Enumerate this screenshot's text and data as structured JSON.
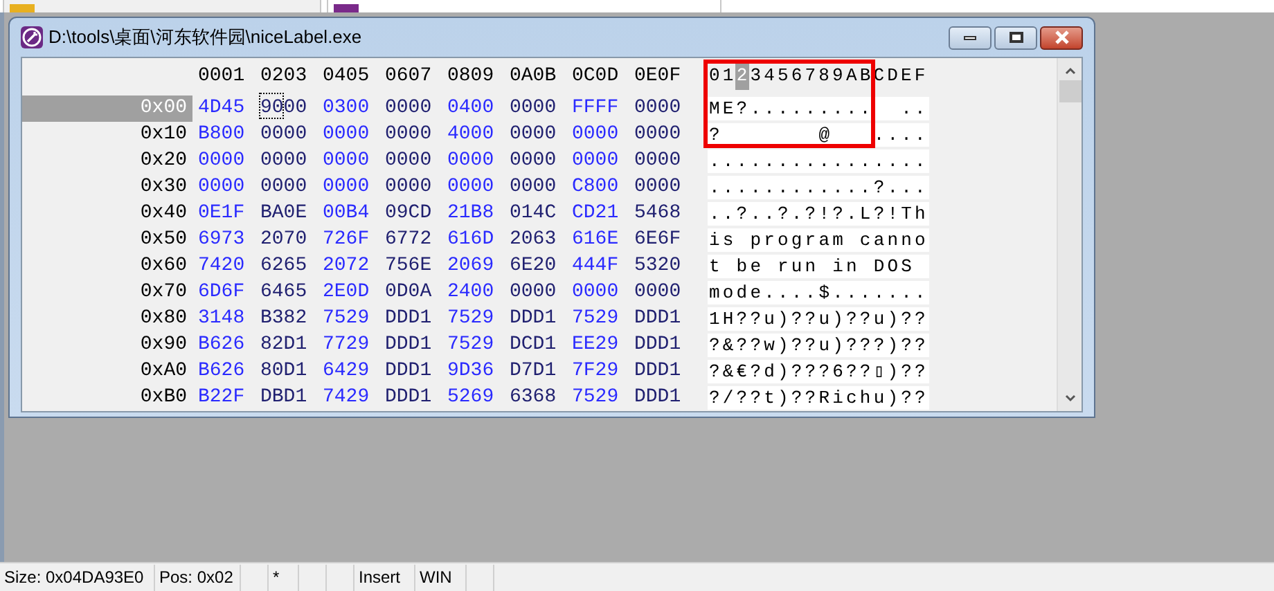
{
  "tabs": [
    {
      "selected": false
    },
    {
      "selected": true
    }
  ],
  "window": {
    "title": "D:\\tools\\桌面\\河东软件园\\niceLabel.exe"
  },
  "hex_columns": [
    "0001",
    "0203",
    "0405",
    "0607",
    "0809",
    "0A0B",
    "0C0D",
    "0E0F"
  ],
  "ascii_header": [
    {
      "char": "0",
      "selected": false
    },
    {
      "char": "1",
      "selected": false
    },
    {
      "char": "2",
      "selected": true
    },
    {
      "char": "3",
      "selected": false
    },
    {
      "char": "4",
      "selected": false
    },
    {
      "char": "5",
      "selected": false
    },
    {
      "char": "6",
      "selected": false
    },
    {
      "char": "7",
      "selected": false
    },
    {
      "char": "8",
      "selected": false
    },
    {
      "char": "9",
      "selected": false
    },
    {
      "char": "A",
      "selected": false
    },
    {
      "char": "B",
      "selected": false
    },
    {
      "char": "C",
      "selected": false
    },
    {
      "char": "D",
      "selected": false
    },
    {
      "char": "E",
      "selected": false
    },
    {
      "char": "F",
      "selected": false
    }
  ],
  "rows": [
    {
      "address": "0x00",
      "selected": true,
      "cells": [
        {
          "text": "4D45",
          "cursor": false
        },
        {
          "text": "9000",
          "cursor": true
        },
        {
          "text": "0300",
          "cursor": false
        },
        {
          "text": "0000",
          "cursor": false
        },
        {
          "text": "0400",
          "cursor": false
        },
        {
          "text": "0000",
          "cursor": false
        },
        {
          "text": "FFFF",
          "cursor": false
        },
        {
          "text": "0000",
          "cursor": false
        }
      ],
      "ascii": "ME?.........  .."
    },
    {
      "address": "0x10",
      "selected": false,
      "cells": [
        {
          "text": "B800",
          "cursor": false
        },
        {
          "text": "0000",
          "cursor": false
        },
        {
          "text": "0000",
          "cursor": false
        },
        {
          "text": "0000",
          "cursor": false
        },
        {
          "text": "4000",
          "cursor": false
        },
        {
          "text": "0000",
          "cursor": false
        },
        {
          "text": "0000",
          "cursor": false
        },
        {
          "text": "0000",
          "cursor": false
        }
      ],
      "ascii": "?       @   ...."
    },
    {
      "address": "0x20",
      "selected": false,
      "cells": [
        {
          "text": "0000",
          "cursor": false
        },
        {
          "text": "0000",
          "cursor": false
        },
        {
          "text": "0000",
          "cursor": false
        },
        {
          "text": "0000",
          "cursor": false
        },
        {
          "text": "0000",
          "cursor": false
        },
        {
          "text": "0000",
          "cursor": false
        },
        {
          "text": "0000",
          "cursor": false
        },
        {
          "text": "0000",
          "cursor": false
        }
      ],
      "ascii": "................"
    },
    {
      "address": "0x30",
      "selected": false,
      "cells": [
        {
          "text": "0000",
          "cursor": false
        },
        {
          "text": "0000",
          "cursor": false
        },
        {
          "text": "0000",
          "cursor": false
        },
        {
          "text": "0000",
          "cursor": false
        },
        {
          "text": "0000",
          "cursor": false
        },
        {
          "text": "0000",
          "cursor": false
        },
        {
          "text": "C800",
          "cursor": false
        },
        {
          "text": "0000",
          "cursor": false
        }
      ],
      "ascii": "............?..."
    },
    {
      "address": "0x40",
      "selected": false,
      "cells": [
        {
          "text": "0E1F",
          "cursor": false
        },
        {
          "text": "BA0E",
          "cursor": false
        },
        {
          "text": "00B4",
          "cursor": false
        },
        {
          "text": "09CD",
          "cursor": false
        },
        {
          "text": "21B8",
          "cursor": false
        },
        {
          "text": "014C",
          "cursor": false
        },
        {
          "text": "CD21",
          "cursor": false
        },
        {
          "text": "5468",
          "cursor": false
        }
      ],
      "ascii": "..?..?.?!?.L?!Th"
    },
    {
      "address": "0x50",
      "selected": false,
      "cells": [
        {
          "text": "6973",
          "cursor": false
        },
        {
          "text": "2070",
          "cursor": false
        },
        {
          "text": "726F",
          "cursor": false
        },
        {
          "text": "6772",
          "cursor": false
        },
        {
          "text": "616D",
          "cursor": false
        },
        {
          "text": "2063",
          "cursor": false
        },
        {
          "text": "616E",
          "cursor": false
        },
        {
          "text": "6E6F",
          "cursor": false
        }
      ],
      "ascii": "is program canno"
    },
    {
      "address": "0x60",
      "selected": false,
      "cells": [
        {
          "text": "7420",
          "cursor": false
        },
        {
          "text": "6265",
          "cursor": false
        },
        {
          "text": "2072",
          "cursor": false
        },
        {
          "text": "756E",
          "cursor": false
        },
        {
          "text": "2069",
          "cursor": false
        },
        {
          "text": "6E20",
          "cursor": false
        },
        {
          "text": "444F",
          "cursor": false
        },
        {
          "text": "5320",
          "cursor": false
        }
      ],
      "ascii": "t be run in DOS"
    },
    {
      "address": "0x70",
      "selected": false,
      "cells": [
        {
          "text": "6D6F",
          "cursor": false
        },
        {
          "text": "6465",
          "cursor": false
        },
        {
          "text": "2E0D",
          "cursor": false
        },
        {
          "text": "0D0A",
          "cursor": false
        },
        {
          "text": "2400",
          "cursor": false
        },
        {
          "text": "0000",
          "cursor": false
        },
        {
          "text": "0000",
          "cursor": false
        },
        {
          "text": "0000",
          "cursor": false
        }
      ],
      "ascii": "mode....$......."
    },
    {
      "address": "0x80",
      "selected": false,
      "cells": [
        {
          "text": "3148",
          "cursor": false
        },
        {
          "text": "B382",
          "cursor": false
        },
        {
          "text": "7529",
          "cursor": false
        },
        {
          "text": "DDD1",
          "cursor": false
        },
        {
          "text": "7529",
          "cursor": false
        },
        {
          "text": "DDD1",
          "cursor": false
        },
        {
          "text": "7529",
          "cursor": false
        },
        {
          "text": "DDD1",
          "cursor": false
        }
      ],
      "ascii": "1H??u)??u)??u)??"
    },
    {
      "address": "0x90",
      "selected": false,
      "cells": [
        {
          "text": "B626",
          "cursor": false
        },
        {
          "text": "82D1",
          "cursor": false
        },
        {
          "text": "7729",
          "cursor": false
        },
        {
          "text": "DDD1",
          "cursor": false
        },
        {
          "text": "7529",
          "cursor": false
        },
        {
          "text": "DCD1",
          "cursor": false
        },
        {
          "text": "EE29",
          "cursor": false
        },
        {
          "text": "DDD1",
          "cursor": false
        }
      ],
      "ascii": "?&??w)??u)???)??"
    },
    {
      "address": "0xA0",
      "selected": false,
      "cells": [
        {
          "text": "B626",
          "cursor": false
        },
        {
          "text": "80D1",
          "cursor": false
        },
        {
          "text": "6429",
          "cursor": false
        },
        {
          "text": "DDD1",
          "cursor": false
        },
        {
          "text": "9D36",
          "cursor": false
        },
        {
          "text": "D7D1",
          "cursor": false
        },
        {
          "text": "7F29",
          "cursor": false
        },
        {
          "text": "DDD1",
          "cursor": false
        }
      ],
      "ascii": "?&€?d)???6??▯)??"
    },
    {
      "address": "0xB0",
      "selected": false,
      "cells": [
        {
          "text": "B22F",
          "cursor": false
        },
        {
          "text": "DBD1",
          "cursor": false
        },
        {
          "text": "7429",
          "cursor": false
        },
        {
          "text": "DDD1",
          "cursor": false
        },
        {
          "text": "5269",
          "cursor": false
        },
        {
          "text": "6368",
          "cursor": false
        },
        {
          "text": "7529",
          "cursor": false
        },
        {
          "text": "DDD1",
          "cursor": false
        }
      ],
      "ascii": "?/??t)??Richu)??"
    }
  ],
  "status_bar": [
    {
      "text": "Size: 0x04DA93E0"
    },
    {
      "text": "Pos: 0x02"
    },
    {
      "text": "*"
    },
    {
      "text": "Insert"
    },
    {
      "text": "WIN"
    }
  ]
}
